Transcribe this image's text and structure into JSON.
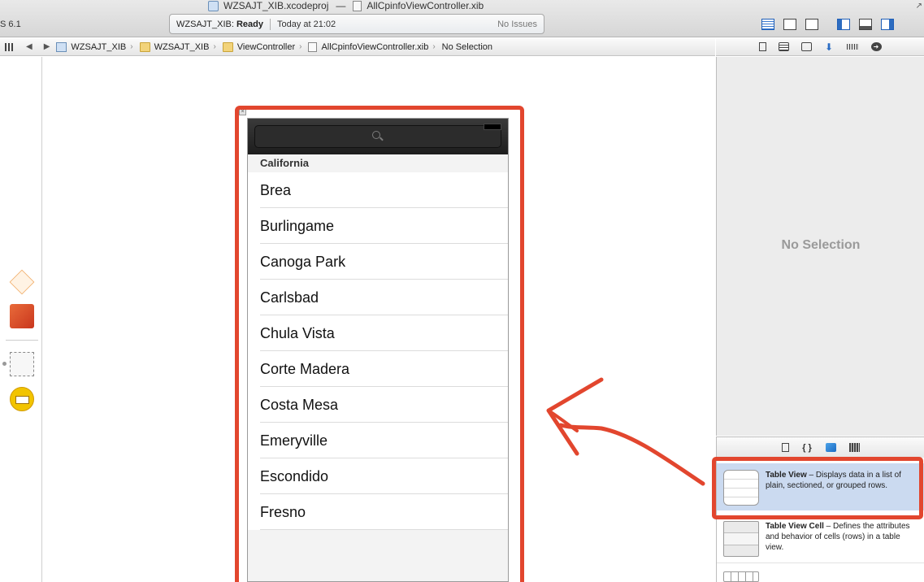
{
  "window": {
    "sdk_label": "S 6.1",
    "project_title": "WZSAJT_XIB.xcodeproj",
    "separator": "—",
    "file_title": "AllCpinfoViewController.xib",
    "corner_arrow": "↗"
  },
  "status": {
    "project": "WZSAJT_XIB:",
    "state": "Ready",
    "time": "Today at 21:02",
    "issues": "No Issues"
  },
  "jumpbar": {
    "back": "◀",
    "forward": "▶",
    "crumbs": [
      "WZSAJT_XIB",
      "WZSAJT_XIB",
      "ViewController",
      "AllCpinfoViewController.xib",
      "No Selection"
    ]
  },
  "canvas": {
    "close_badge": "×",
    "section_header": "California",
    "rows": [
      "Brea",
      "Burlingame",
      "Canoga Park",
      "Carlsbad",
      "Chula Vista",
      "Corte Madera",
      "Costa Mesa",
      "Emeryville",
      "Escondido",
      "Fresno"
    ]
  },
  "inspector": {
    "no_selection": "No Selection"
  },
  "library_tabs": {
    "snippet": "{ }"
  },
  "library": {
    "table_view": {
      "title": "Table View",
      "desc": " – Displays data in a list of plain, sectioned, or grouped rows."
    },
    "table_view_cell": {
      "title": "Table View Cell",
      "desc": " – Defines the attributes and behavior of cells (rows) in a table view."
    }
  },
  "colors": {
    "annotation_red": "#e2462e",
    "selection_blue": "#cbdaf0"
  }
}
